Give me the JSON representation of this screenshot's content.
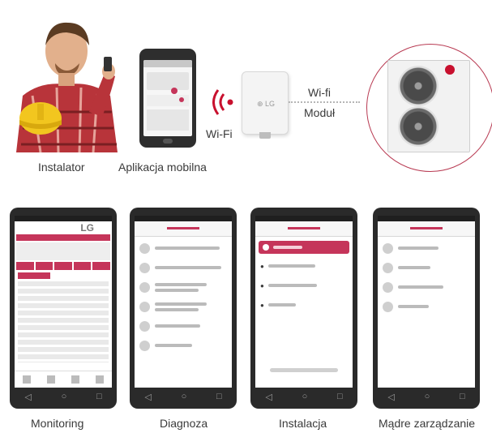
{
  "top": {
    "captions": {
      "installer": "Instalator",
      "mobile_app": "Aplikacja mobilna",
      "wifi_signal": "Wi-Fi",
      "wifi_module": [
        "Wi-fi",
        "Moduł"
      ]
    }
  },
  "screens": {
    "monitoring": {
      "caption": "Monitoring",
      "logo": "LG"
    },
    "diagnosis": {
      "caption": "Diagnoza"
    },
    "installation": {
      "caption": "Instalacja"
    },
    "management": {
      "caption": "Mądre zarządzanie"
    }
  },
  "colors": {
    "accent": "#c5355a",
    "wifi_signal": "#c8102e",
    "circle": "#b83a52"
  },
  "icons": [
    "installer-photo",
    "tablet-icon",
    "wifi-signal-icon",
    "wifi-module-icon",
    "outdoor-unit-icon",
    "back-nav-icon",
    "home-nav-icon",
    "recent-nav-icon"
  ]
}
